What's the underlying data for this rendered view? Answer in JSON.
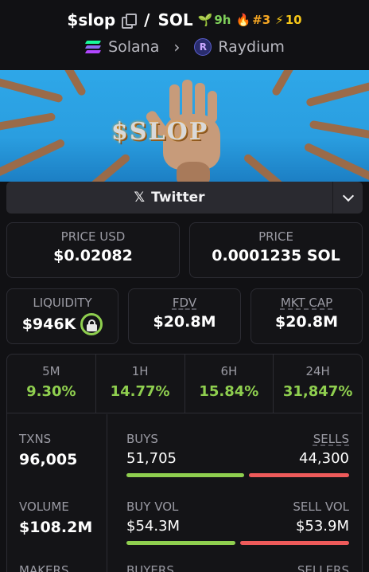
{
  "header": {
    "ticker": "$slop",
    "quote": "SOL",
    "separator": "/",
    "age": "9h",
    "rank": "#3",
    "boosts": "10",
    "chain": "Solana",
    "dex": "Raydium",
    "icons": [
      "copy-icon",
      "sprout-icon",
      "fire-icon",
      "bolt-icon",
      "solana-icon",
      "chevron-right-icon",
      "raydium-icon"
    ],
    "colors": {
      "age": "#7fcf5a",
      "rank": "#f5a623",
      "boost": "#f5c518"
    }
  },
  "banner": {
    "text": "$SLOP"
  },
  "socials": {
    "twitter_label": "Twitter",
    "icons": [
      "x-icon",
      "chevron-down-icon"
    ]
  },
  "prices": {
    "usd_label": "PRICE USD",
    "usd_value": "$0.02082",
    "native_label": "PRICE",
    "native_value": "0.0001235 SOL"
  },
  "market": {
    "liquidity_label": "LIQUIDITY",
    "liquidity_value": "$946K",
    "fdv_label": "FDV",
    "fdv_value": "$20.8M",
    "mktcap_label": "MKT CAP",
    "mktcap_value": "$20.8M"
  },
  "timeframes": [
    {
      "label": "5M",
      "change": "9.30%"
    },
    {
      "label": "1H",
      "change": "14.77%"
    },
    {
      "label": "6H",
      "change": "15.84%"
    },
    {
      "label": "24H",
      "change": "31,847%"
    }
  ],
  "stats": {
    "txns_label": "TXNS",
    "txns_value": "96,005",
    "volume_label": "VOLUME",
    "volume_value": "$108.2M",
    "makers_label": "MAKERS",
    "buys_label": "BUYS",
    "buys_value": "51,705",
    "sells_label": "SELLS",
    "sells_value": "44,300",
    "buys_share": 0.54,
    "buyvol_label": "BUY VOL",
    "buyvol_value": "$54.3M",
    "sellvol_label": "SELL VOL",
    "sellvol_value": "$53.9M",
    "buyvol_share": 0.5,
    "buyers_label": "BUYERS",
    "sellers_label": "SELLERS",
    "colors": {
      "positive": "#8fcf4f",
      "negative": "#ee5a5a"
    }
  }
}
